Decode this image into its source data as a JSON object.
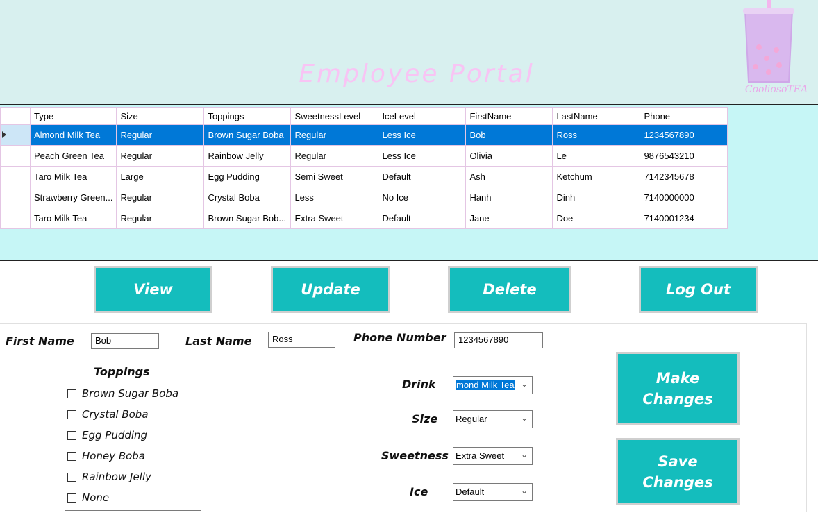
{
  "header": {
    "title": "Employee Portal",
    "logo_text": "CooliosoTEA"
  },
  "grid": {
    "columns": [
      "Type",
      "Size",
      "Toppings",
      "SweetnessLevel",
      "IceLevel",
      "FirstName",
      "LastName",
      "Phone"
    ],
    "rows": [
      [
        "Almond Milk Tea",
        "Regular",
        "Brown Sugar Boba",
        "Regular",
        "Less Ice",
        "Bob",
        "Ross",
        "1234567890"
      ],
      [
        "Peach Green Tea",
        "Regular",
        "Rainbow Jelly",
        "Regular",
        "Less Ice",
        "Olivia",
        "Le",
        "9876543210"
      ],
      [
        "Taro Milk Tea",
        "Large",
        "Egg Pudding",
        "Semi Sweet",
        "Default",
        "Ash",
        "Ketchum",
        "7142345678"
      ],
      [
        "Strawberry Green...",
        "Regular",
        "Crystal Boba",
        "Less",
        "No Ice",
        "Hanh",
        "Dinh",
        "7140000000"
      ],
      [
        "Taro Milk Tea",
        "Regular",
        "Brown Sugar Bob...",
        "Extra Sweet",
        "Default",
        "Jane",
        "Doe",
        "7140001234"
      ]
    ],
    "selected_row": 0
  },
  "actions": {
    "view": "View",
    "update": "Update",
    "delete": "Delete",
    "logout": "Log Out"
  },
  "form": {
    "first_name_label": "First Name",
    "first_name_value": "Bob",
    "last_name_label": "Last Name",
    "last_name_value": "Ross",
    "phone_label": "Phone Number",
    "phone_value": "1234567890",
    "toppings_label": "Toppings",
    "toppings": [
      "Brown Sugar Boba",
      "Crystal Boba",
      "Egg Pudding",
      "Honey Boba",
      "Rainbow Jelly",
      "None"
    ],
    "drink_label": "Drink",
    "drink_value": "mond Milk Tea",
    "size_label": "Size",
    "size_value": "Regular",
    "sweetness_label": "Sweetness",
    "sweetness_value": "Extra Sweet",
    "ice_label": "Ice",
    "ice_value": "Default",
    "make_changes_1": "Make",
    "make_changes_2": "Changes",
    "save_changes_1": "Save",
    "save_changes_2": "Changes"
  },
  "colors": {
    "accent": "#14bdbd",
    "header_bg": "#d8f0ef",
    "grid_bg": "#c6f6f6",
    "title_pink": "#f8c4f4",
    "selection_blue": "#0078d7"
  }
}
